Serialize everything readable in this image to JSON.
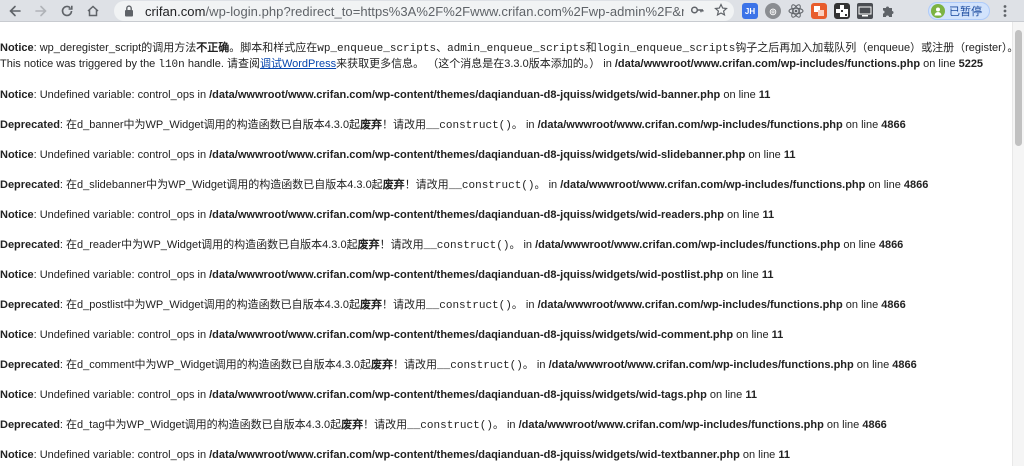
{
  "browser": {
    "url_host": "crifan.com",
    "url_rest": "/wp-login.php?redirect_to=https%3A%2F%2Fwww.crifan.com%2Fwp-admin%2F&reau...",
    "profile_label": "已暂停",
    "extensions": {
      "jh": "JH",
      "gb": "◎"
    }
  },
  "first_notice": {
    "label": "Notice",
    "line1_a": ": wp_deregister_script的调用方法",
    "line1_b": "不正确",
    "line1_c": "。脚本和样式应在",
    "line1_code1": "wp_enqueue_scripts",
    "line1_sep1": "、",
    "line1_code2": "admin_enqueue_scripts",
    "line1_sep2": "和",
    "line1_code3": "login_enqueue_scripts",
    "line1_d": "钩子之后再加入加载队列（enqueue）或注册（register）。",
    "line2_a": "This notice was triggered by the ",
    "line2_code": "l10n",
    "line2_b": " handle. 请查阅",
    "line2_link": "调试WordPress",
    "line2_c": "来获取更多信息。 （这个消息是在3.3.0版本添加的。） in ",
    "line2_path": "/data/wwwroot/www.crifan.com/wp-includes/functions.php",
    "line2_d": " on line ",
    "line2_num": "5225"
  },
  "messages": [
    {
      "label": "Notice",
      "text_a": ": Undefined variable: control_ops in ",
      "path": "/data/wwwroot/www.crifan.com/wp-content/themes/daqianduan-d8-jquiss/widgets/wid-banner.php",
      "text_b": " on line ",
      "line": "11"
    },
    {
      "label": "Deprecated",
      "text_a": ": 在d_banner中为WP_Widget调用的构造函数已自版本4.3.0起",
      "bold": "废弃",
      "text_c": "！请改用",
      "code": "__construct()",
      "text_d": "。 in ",
      "path": "/data/wwwroot/www.crifan.com/wp-includes/functions.php",
      "text_b": " on line ",
      "line": "4866"
    },
    {
      "label": "Notice",
      "text_a": ": Undefined variable: control_ops in ",
      "path": "/data/wwwroot/www.crifan.com/wp-content/themes/daqianduan-d8-jquiss/widgets/wid-slidebanner.php",
      "text_b": " on line ",
      "line": "11"
    },
    {
      "label": "Deprecated",
      "text_a": ": 在d_slidebanner中为WP_Widget调用的构造函数已自版本4.3.0起",
      "bold": "废弃",
      "text_c": "！请改用",
      "code": "__construct()",
      "text_d": "。 in ",
      "path": "/data/wwwroot/www.crifan.com/wp-includes/functions.php",
      "text_b": " on line ",
      "line": "4866"
    },
    {
      "label": "Notice",
      "text_a": ": Undefined variable: control_ops in ",
      "path": "/data/wwwroot/www.crifan.com/wp-content/themes/daqianduan-d8-jquiss/widgets/wid-readers.php",
      "text_b": " on line ",
      "line": "11"
    },
    {
      "label": "Deprecated",
      "text_a": ": 在d_reader中为WP_Widget调用的构造函数已自版本4.3.0起",
      "bold": "废弃",
      "text_c": "！请改用",
      "code": "__construct()",
      "text_d": "。 in ",
      "path": "/data/wwwroot/www.crifan.com/wp-includes/functions.php",
      "text_b": " on line ",
      "line": "4866"
    },
    {
      "label": "Notice",
      "text_a": ": Undefined variable: control_ops in ",
      "path": "/data/wwwroot/www.crifan.com/wp-content/themes/daqianduan-d8-jquiss/widgets/wid-postlist.php",
      "text_b": " on line ",
      "line": "11"
    },
    {
      "label": "Deprecated",
      "text_a": ": 在d_postlist中为WP_Widget调用的构造函数已自版本4.3.0起",
      "bold": "废弃",
      "text_c": "！请改用",
      "code": "__construct()",
      "text_d": "。 in ",
      "path": "/data/wwwroot/www.crifan.com/wp-includes/functions.php",
      "text_b": " on line ",
      "line": "4866"
    },
    {
      "label": "Notice",
      "text_a": ": Undefined variable: control_ops in ",
      "path": "/data/wwwroot/www.crifan.com/wp-content/themes/daqianduan-d8-jquiss/widgets/wid-comment.php",
      "text_b": " on line ",
      "line": "11"
    },
    {
      "label": "Deprecated",
      "text_a": ": 在d_comment中为WP_Widget调用的构造函数已自版本4.3.0起",
      "bold": "废弃",
      "text_c": "！请改用",
      "code": "__construct()",
      "text_d": "。 in ",
      "path": "/data/wwwroot/www.crifan.com/wp-includes/functions.php",
      "text_b": " on line ",
      "line": "4866"
    },
    {
      "label": "Notice",
      "text_a": ": Undefined variable: control_ops in ",
      "path": "/data/wwwroot/www.crifan.com/wp-content/themes/daqianduan-d8-jquiss/widgets/wid-tags.php",
      "text_b": " on line ",
      "line": "11"
    },
    {
      "label": "Deprecated",
      "text_a": ": 在d_tag中为WP_Widget调用的构造函数已自版本4.3.0起",
      "bold": "废弃",
      "text_c": "！请改用",
      "code": "__construct()",
      "text_d": "。 in ",
      "path": "/data/wwwroot/www.crifan.com/wp-includes/functions.php",
      "text_b": " on line ",
      "line": "4866"
    },
    {
      "label": "Notice",
      "text_a": ": Undefined variable: control_ops in ",
      "path": "/data/wwwroot/www.crifan.com/wp-content/themes/daqianduan-d8-jquiss/widgets/wid-textbanner.php",
      "text_b": " on line ",
      "line": "11"
    }
  ]
}
